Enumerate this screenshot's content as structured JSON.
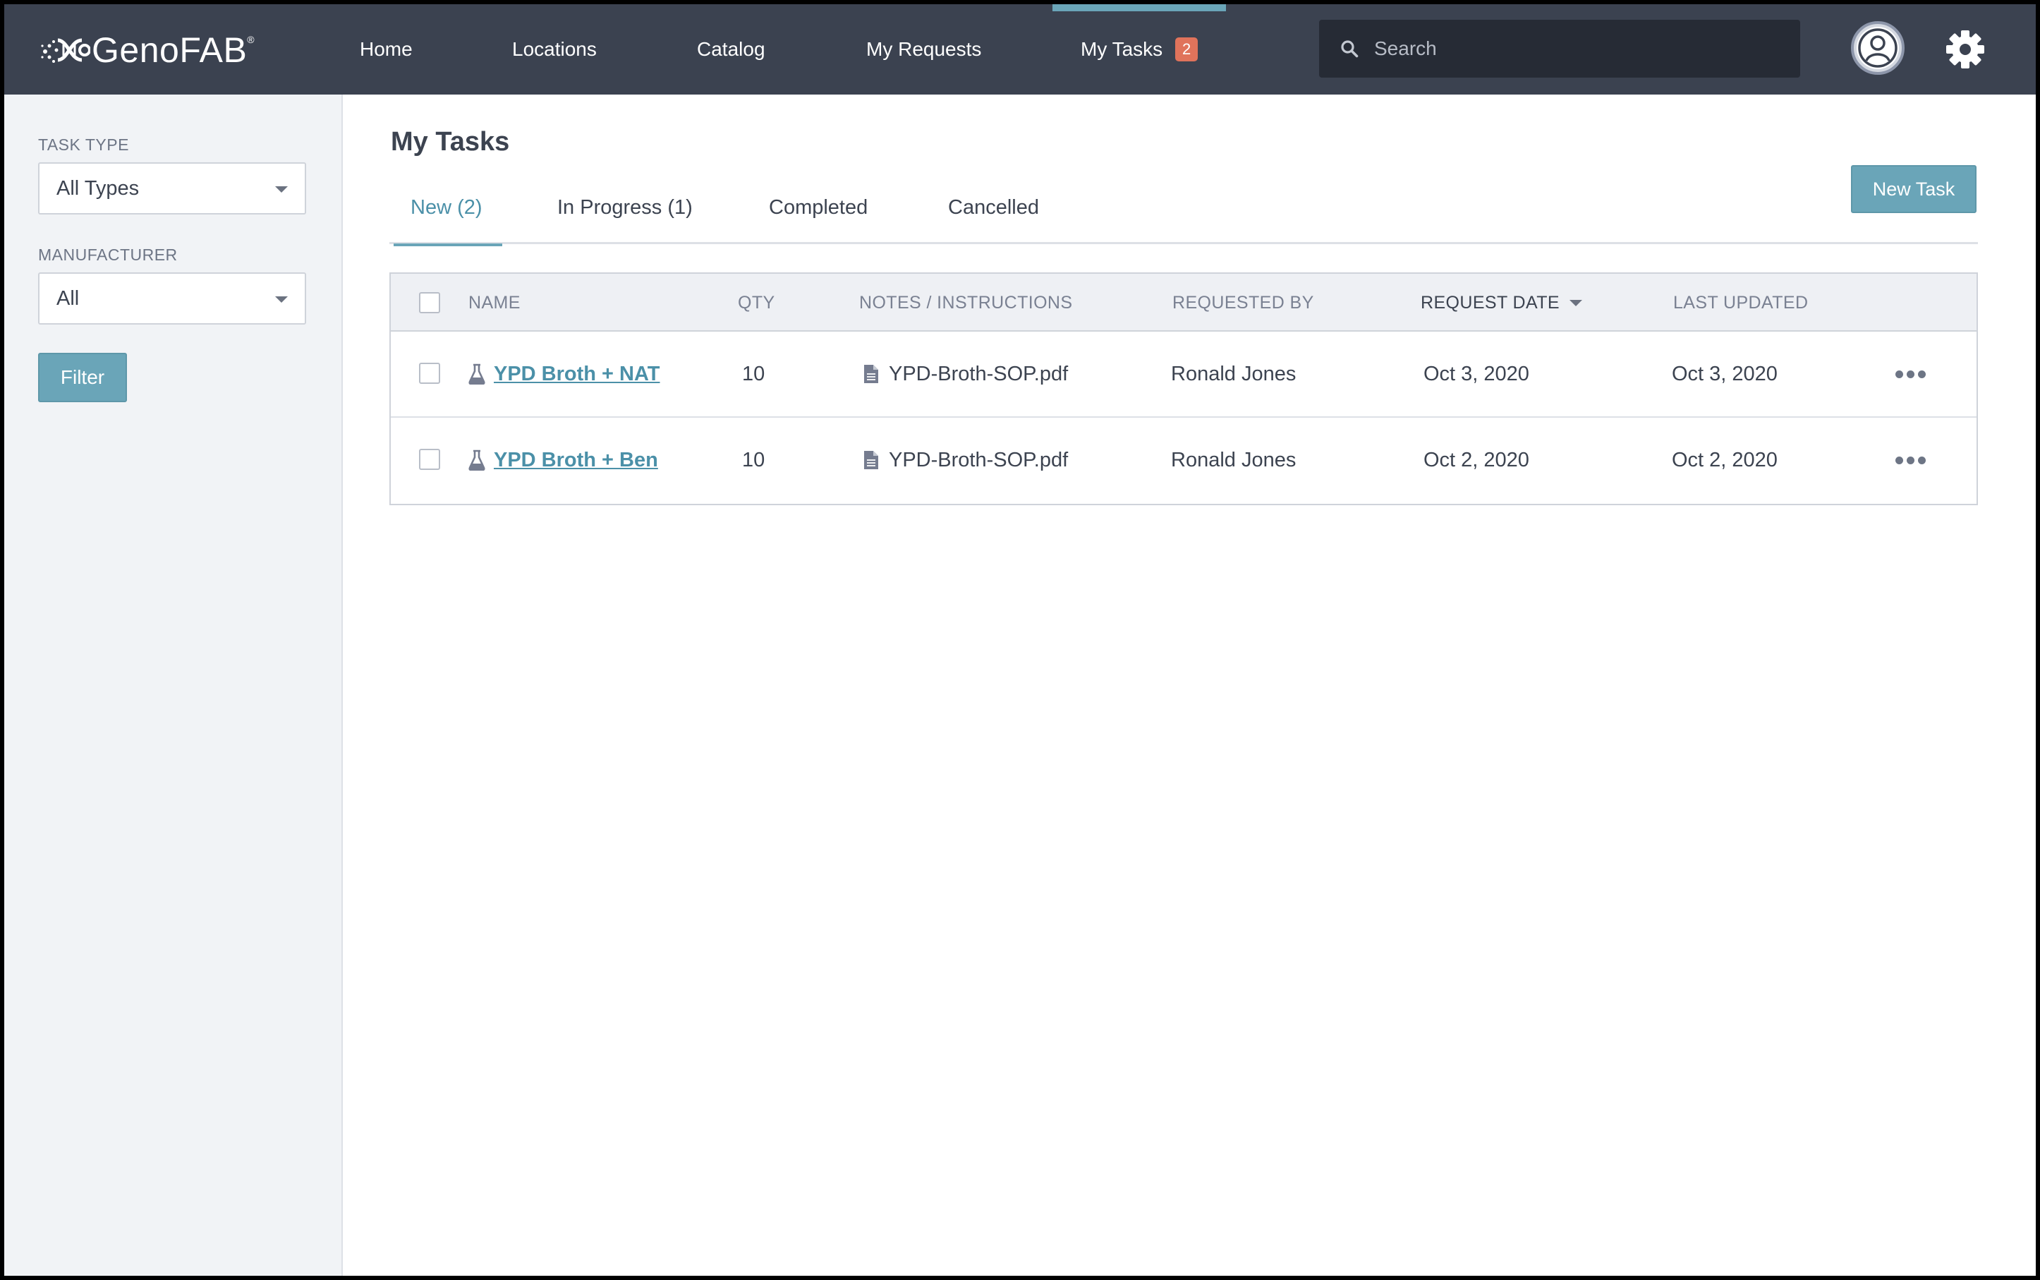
{
  "app": {
    "logo_text": "GenoFAB",
    "logo_mark": "®"
  },
  "nav": {
    "items": [
      {
        "label": "Home"
      },
      {
        "label": "Locations"
      },
      {
        "label": "Catalog"
      },
      {
        "label": "My Requests"
      },
      {
        "label": "My Tasks",
        "badge": "2",
        "active": true
      }
    ]
  },
  "search": {
    "placeholder": "Search",
    "value": ""
  },
  "sidebar": {
    "task_type_label": "TASK TYPE",
    "task_type_value": "All Types",
    "manufacturer_label": "MANUFACTURER",
    "manufacturer_value": "All",
    "filter_label": "Filter"
  },
  "page": {
    "title": "My Tasks",
    "new_task_label": "New Task"
  },
  "tabs": [
    {
      "label": "New (2)",
      "active": true
    },
    {
      "label": "In Progress (1)"
    },
    {
      "label": "Completed"
    },
    {
      "label": "Cancelled"
    }
  ],
  "table": {
    "columns": [
      "NAME",
      "QTY",
      "NOTES / INSTRUCTIONS",
      "REQUESTED BY",
      "REQUEST DATE",
      "LAST UPDATED"
    ],
    "sorted_column": "REQUEST DATE",
    "rows": [
      {
        "name": "YPD Broth + NAT",
        "qty": "10",
        "notes": "YPD-Broth-SOP.pdf",
        "requested_by": "Ronald Jones",
        "request_date": "Oct 3, 2020",
        "last_updated": "Oct 3, 2020"
      },
      {
        "name": "YPD Broth + Ben",
        "qty": "10",
        "notes": "YPD-Broth-SOP.pdf",
        "requested_by": "Ronald Jones",
        "request_date": "Oct 2, 2020",
        "last_updated": "Oct 2, 2020"
      }
    ]
  },
  "colors": {
    "nav_bg": "#3b4250",
    "accent": "#6aa5b8",
    "badge": "#e0735b",
    "link": "#4b90a8",
    "sidebar_bg": "#f1f3f6"
  },
  "icons": {
    "search": "search-icon",
    "avatar": "user-avatar-icon",
    "settings": "gear-icon",
    "task_type": "flask-icon",
    "file": "document-icon",
    "row_menu": "more-horizontal-icon"
  }
}
